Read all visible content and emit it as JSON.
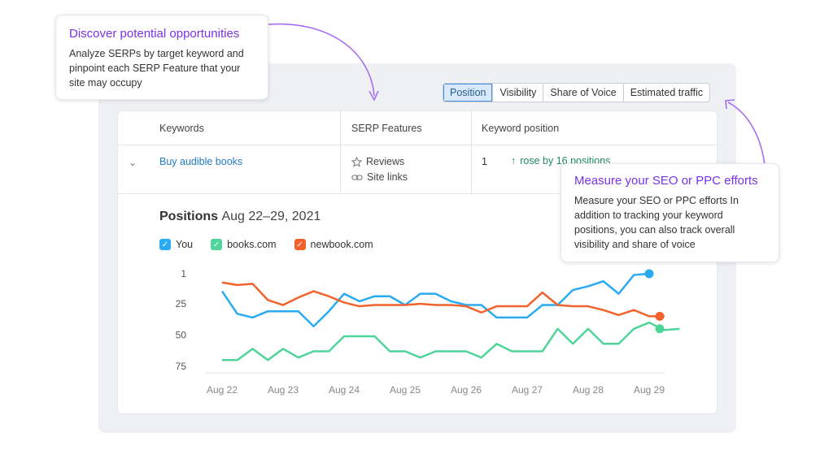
{
  "tabs": [
    "Position",
    "Visibility",
    "Share of Voice",
    "Estimated traffic"
  ],
  "table": {
    "headers": [
      "Keywords",
      "SERP Features",
      "Keyword position"
    ],
    "row": {
      "keyword": "Buy audible books",
      "features": [
        "Reviews",
        "Site links"
      ],
      "position": "1",
      "change": "rose by 16 positions"
    }
  },
  "positions": {
    "title": "Positions",
    "dates": "Aug 22–29, 2021"
  },
  "callouts": {
    "discover": {
      "title": "Discover potential opportunities",
      "body": "Analyze SERPs by target keyword and pinpoint each SERP Feature that your site may occupy"
    },
    "measure": {
      "title": "Measure your SEO or PPC efforts",
      "body": "Measure your SEO or PPC efforts In addition to tracking your keyword positions, you can also track overall visibility and share of voice"
    }
  },
  "colors": {
    "you": "#2aaaf0",
    "books": "#4fd49a",
    "newbook": "#f2632b",
    "accent": "#7a32e8",
    "link": "#1f7bc7"
  },
  "chart_data": {
    "type": "line",
    "y_inverted": true,
    "ylim": [
      1,
      75
    ],
    "yticks": [
      "1",
      "25",
      "50",
      "75"
    ],
    "ytick_values": [
      1,
      25,
      50,
      75
    ],
    "categories": [
      "Aug 22",
      "Aug 23",
      "Aug 24",
      "Aug 25",
      "Aug 26",
      "Aug 27",
      "Aug 28",
      "Aug 29"
    ],
    "x_step": 0.25,
    "series": [
      {
        "name": "You",
        "color": "#2aaaf0",
        "values": [
          15,
          33,
          36,
          31,
          31,
          31,
          43,
          31,
          17,
          23,
          19,
          19,
          26,
          17,
          17,
          23,
          26,
          26,
          36,
          36,
          36,
          26,
          26,
          14,
          11,
          7,
          17,
          2,
          1
        ]
      },
      {
        "name": "books.com",
        "color": "#4fd49a",
        "values": [
          70,
          70,
          61,
          70,
          61,
          68,
          63,
          63,
          51,
          51,
          51,
          63,
          63,
          68,
          63,
          63,
          63,
          68,
          57,
          63,
          63,
          63,
          45,
          57,
          45,
          57,
          57,
          45,
          40,
          46,
          45
        ]
      },
      {
        "name": "newbook.com",
        "color": "#f2632b",
        "values": [
          8,
          10,
          9,
          22,
          26,
          20,
          15,
          19,
          24,
          27,
          26,
          26,
          26,
          25,
          26,
          26,
          27,
          32,
          27,
          27,
          27,
          16,
          26,
          27,
          27,
          30,
          34,
          30,
          35,
          35
        ]
      }
    ]
  }
}
